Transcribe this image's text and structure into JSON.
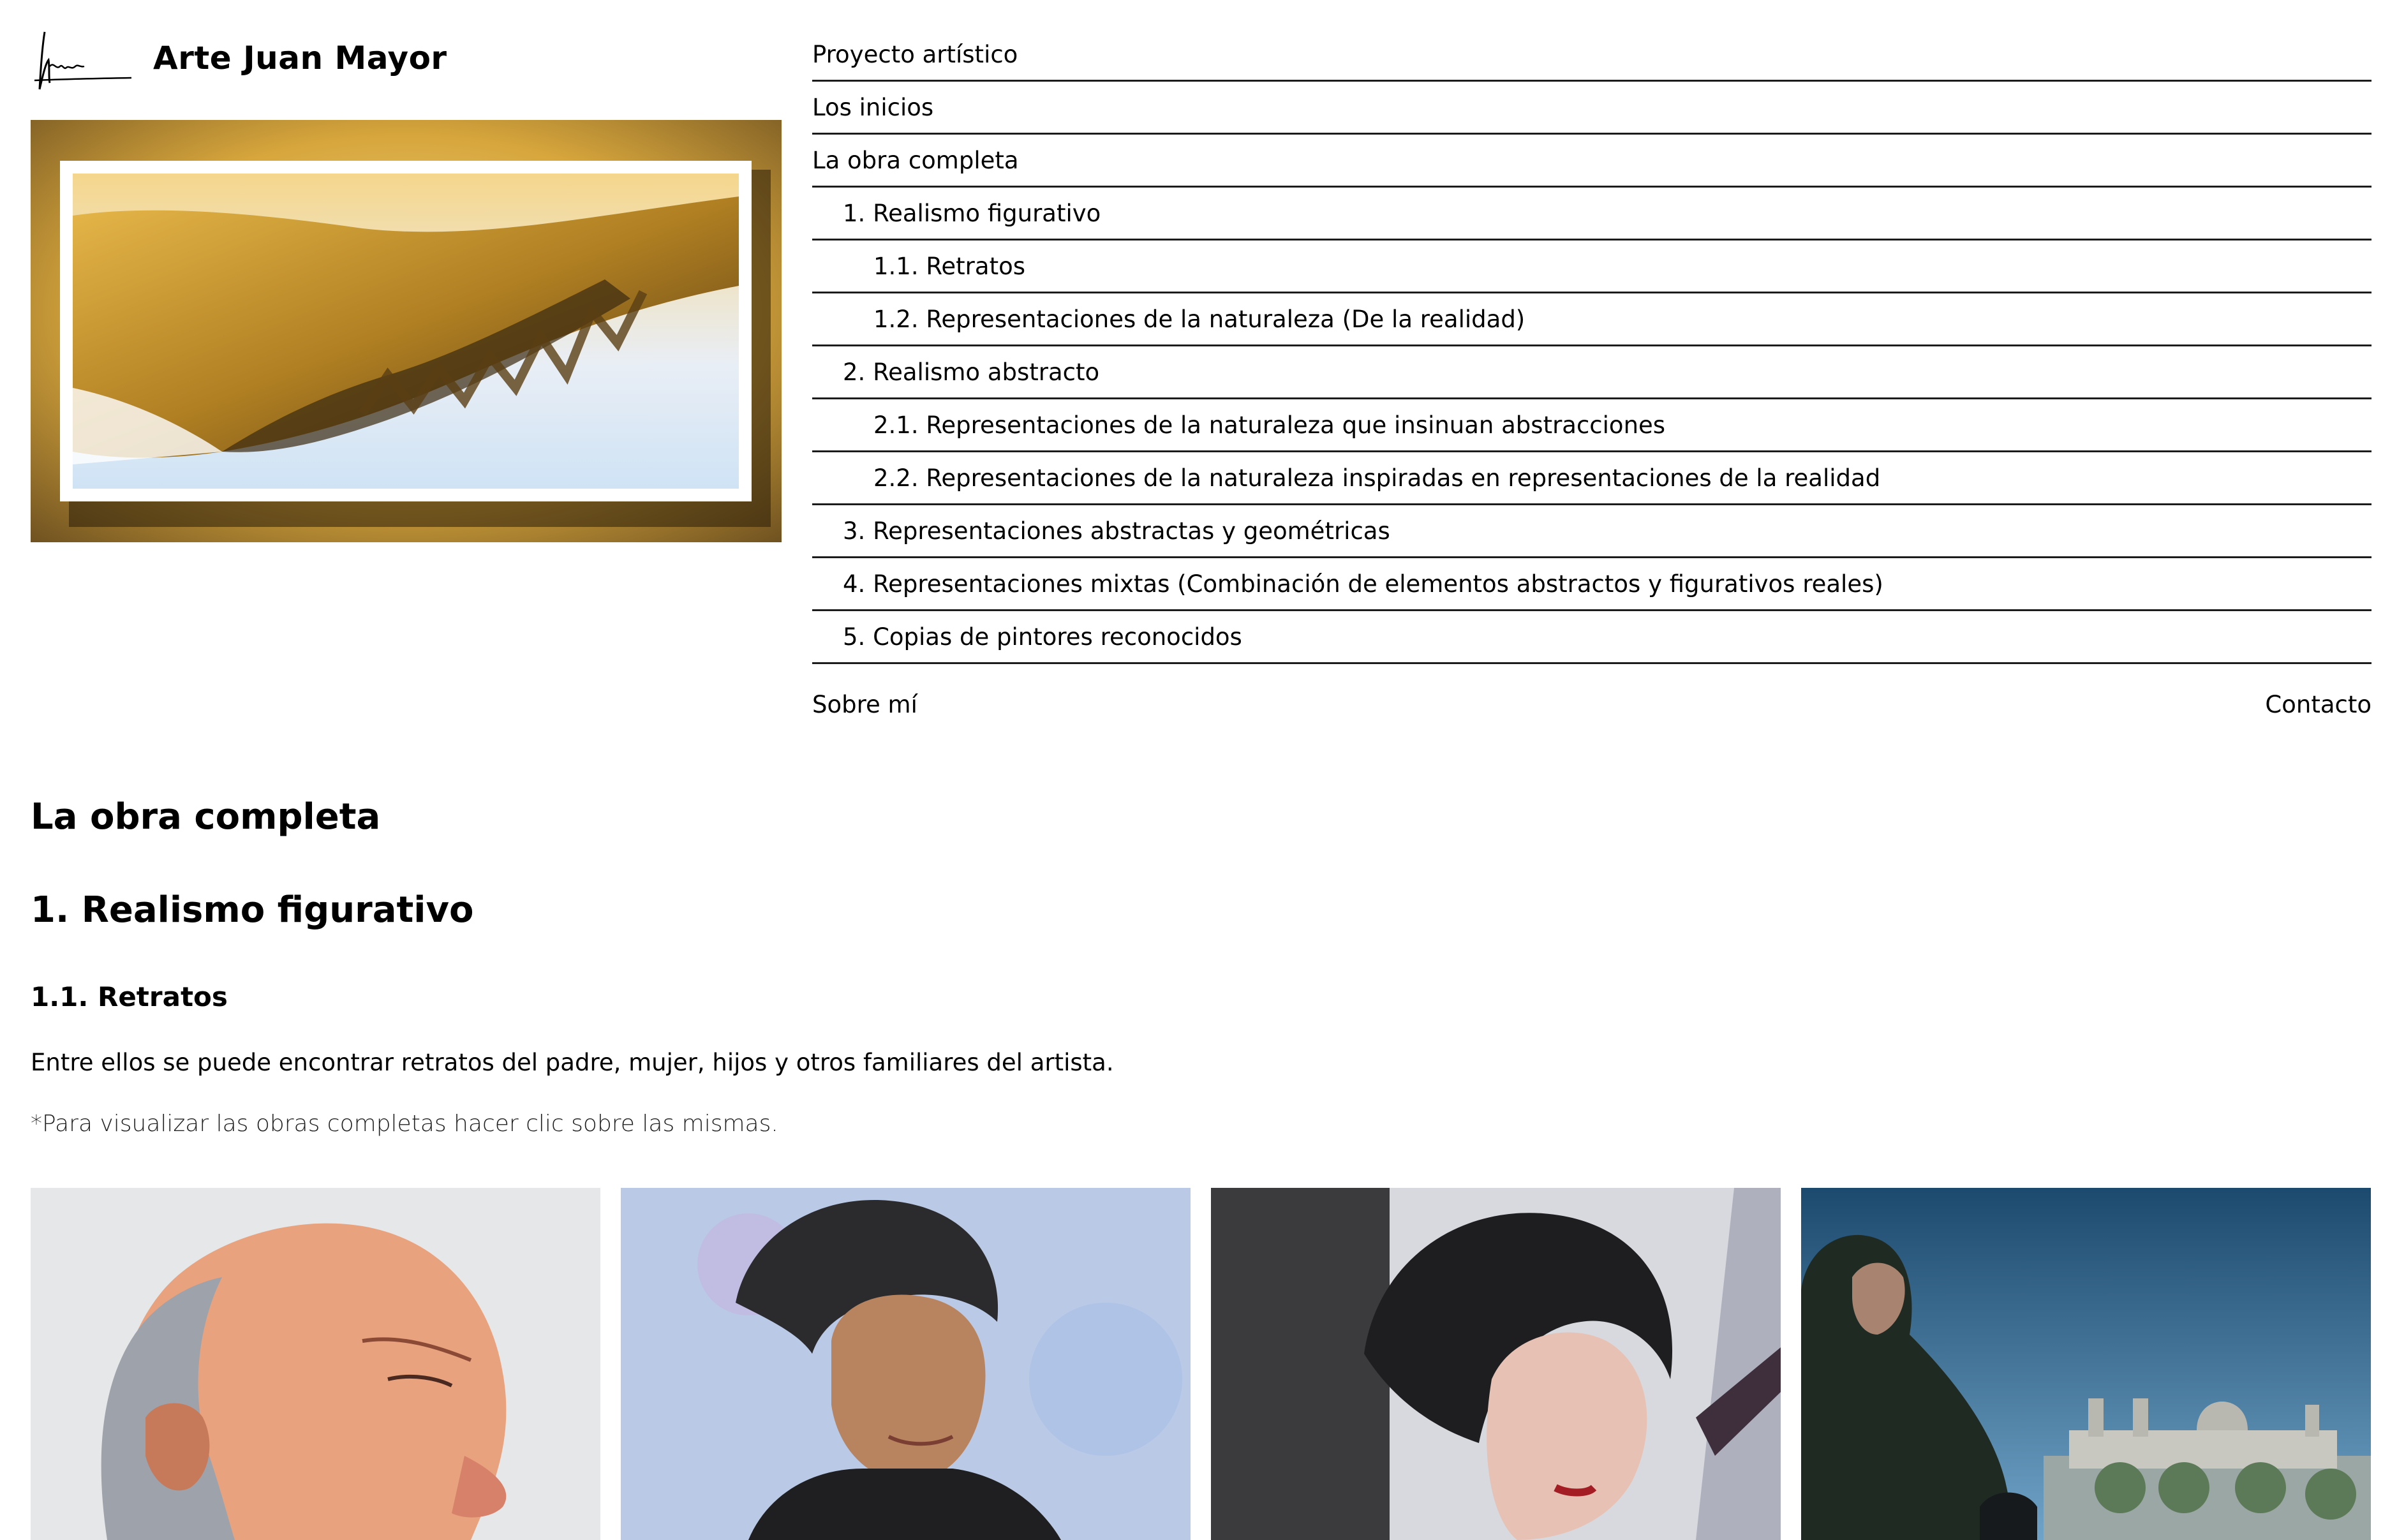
{
  "header": {
    "site_title": "Arte Juan Mayor",
    "logo_icon": "signature-logo-icon"
  },
  "nav": {
    "items": [
      {
        "label": "Proyecto artístico",
        "level": 0
      },
      {
        "label": "Los inicios",
        "level": 0
      },
      {
        "label": "La obra completa",
        "level": 0
      },
      {
        "label": "1. Realismo figurativo",
        "level": 1
      },
      {
        "label": "1.1. Retratos",
        "level": 2
      },
      {
        "label": "1.2. Representaciones de la naturaleza (De la realidad)",
        "level": 2
      },
      {
        "label": "2. Realismo abstracto",
        "level": 1
      },
      {
        "label": "2.1. Representaciones de la naturaleza que insinuan abstracciones",
        "level": 2
      },
      {
        "label": "2.2. Representaciones de la naturaleza inspiradas en representaciones de la realidad",
        "level": 2
      },
      {
        "label": "3. Representaciones abstractas y geométricas",
        "level": 1
      },
      {
        "label": "4. Representaciones mixtas (Combinación de elementos abstractos y figurativos reales)",
        "level": 1
      },
      {
        "label": "5. Copias de pintores reconocidos",
        "level": 1
      }
    ],
    "about": "Sobre mí",
    "contact": "Contacto"
  },
  "content": {
    "h1": "La obra completa",
    "h2": "1. Realismo figurativo",
    "h3": "1.1. Retratos",
    "intro": "Entre ellos se puede encontrar retratos del padre, mujer, hijos y otros familiares del artista.",
    "note": "*Para visualizar las obras completas hacer clic sobre las mismas."
  },
  "colors": {
    "nav_border": "#1c1c1c",
    "text": "#000000",
    "hero_gold": "#d9a838"
  }
}
